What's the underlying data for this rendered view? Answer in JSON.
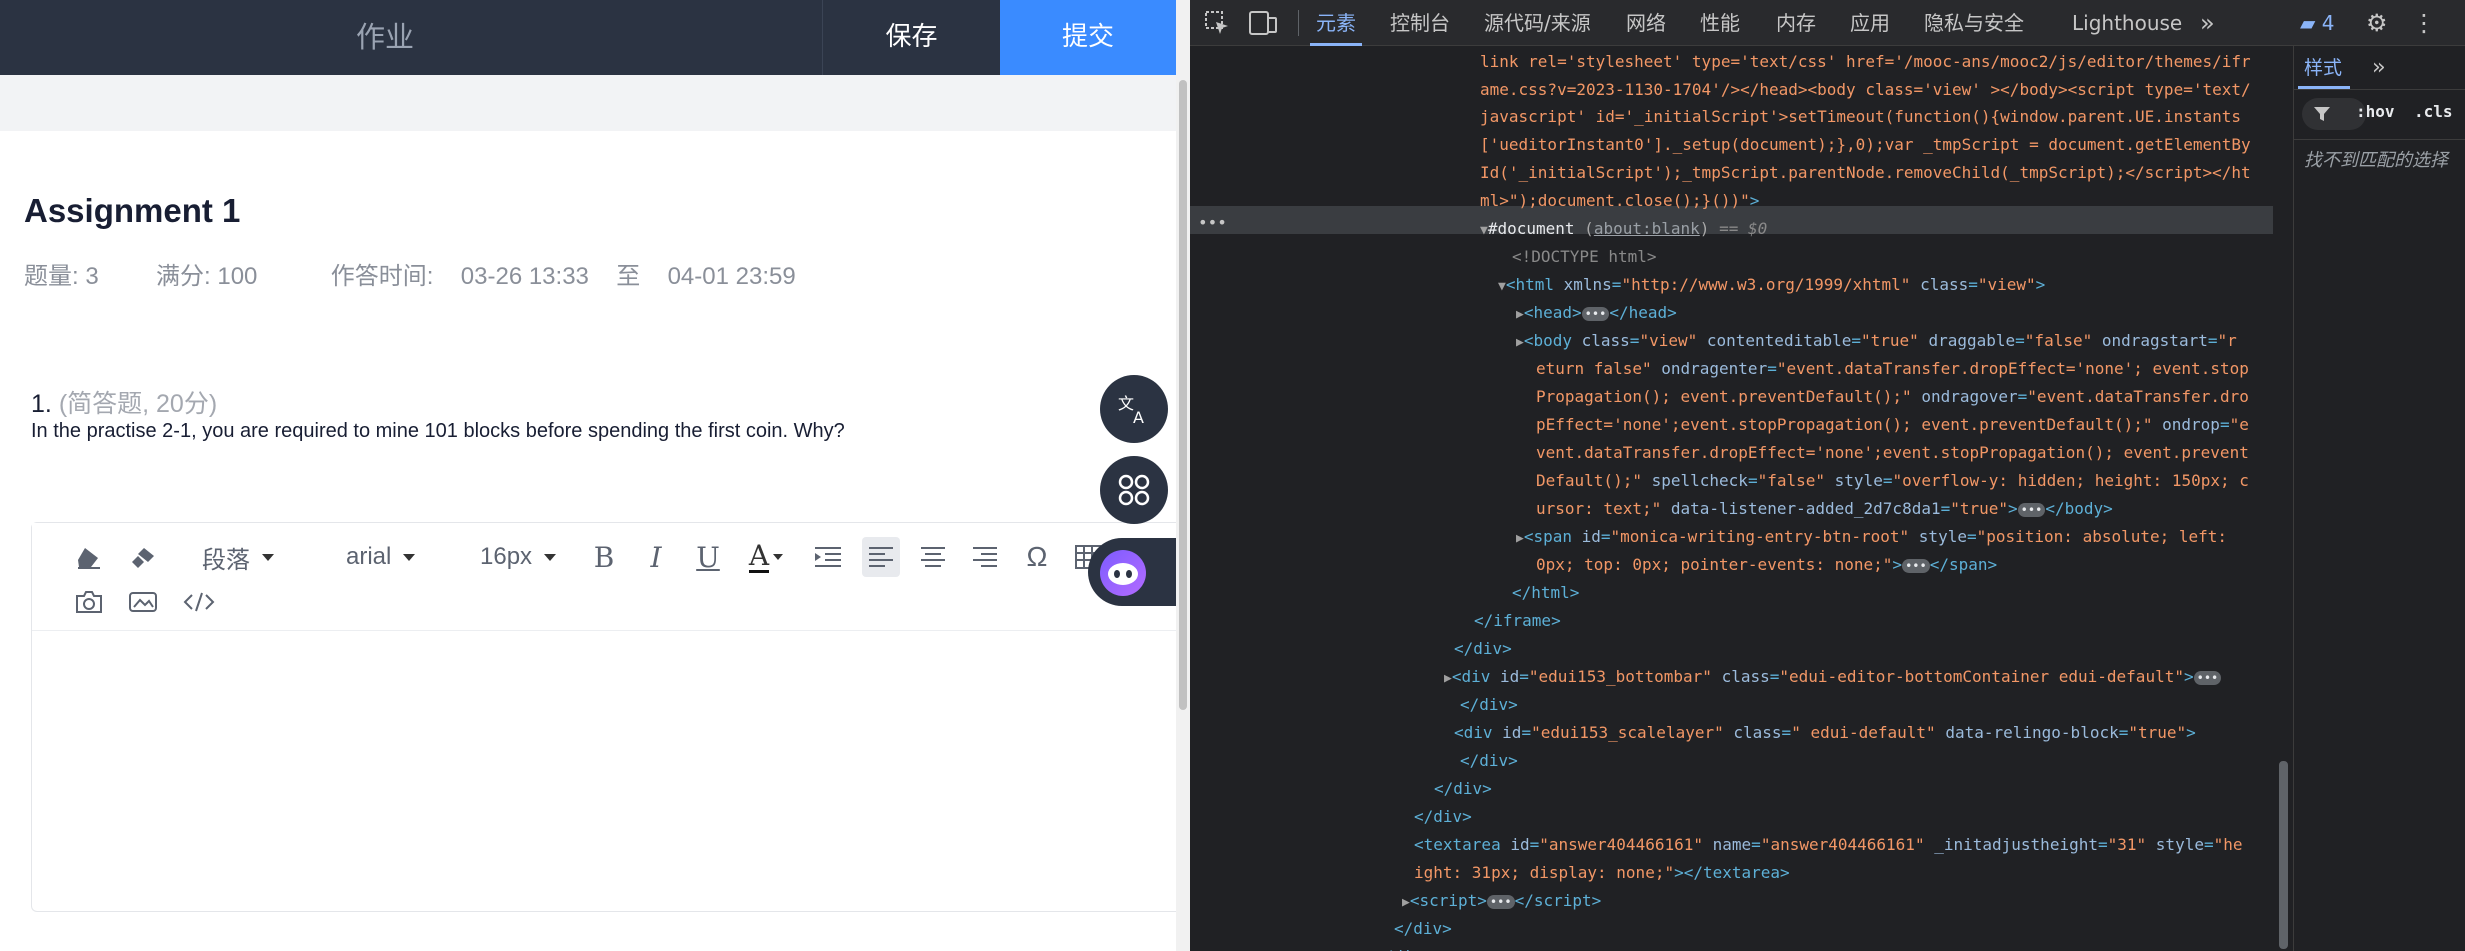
{
  "topbar": {
    "title": "作业",
    "save_label": "保存",
    "submit_label": "提交"
  },
  "assignment": {
    "title": "Assignment 1",
    "count": "题量: 3",
    "score": "满分: 100",
    "time_label": "作答时间:",
    "time_start": "03-26 13:33",
    "time_sep": "至",
    "time_end": "04-01 23:59"
  },
  "question": {
    "number": "1.",
    "type": "(简答题, 20分)",
    "text": "In the practise 2-1, you are required to mine 101 blocks before spending the first coin. Why?"
  },
  "editor_toolbar": {
    "paragraph": "段落",
    "font": "arial",
    "size": "16px",
    "bold": "B",
    "italic": "I",
    "underline": "U",
    "font_color": "A",
    "omega": "Ω"
  },
  "colors": {
    "accent": "#3a8bff",
    "topbar": "#2b3342"
  },
  "devtools": {
    "tabs": [
      "元素",
      "控制台",
      "源代码/来源",
      "网络",
      "性能",
      "内存",
      "应用",
      "隐私与安全",
      "Lighthouse"
    ],
    "issues_count": "4",
    "styles_tab": "样式",
    "filter_hov": ":hov",
    "filter_cls": ".cls",
    "no_match": "找不到匹配的选择",
    "about_blank": "about:blank",
    "dollar0": "== $0",
    "doc_name": "#document"
  }
}
